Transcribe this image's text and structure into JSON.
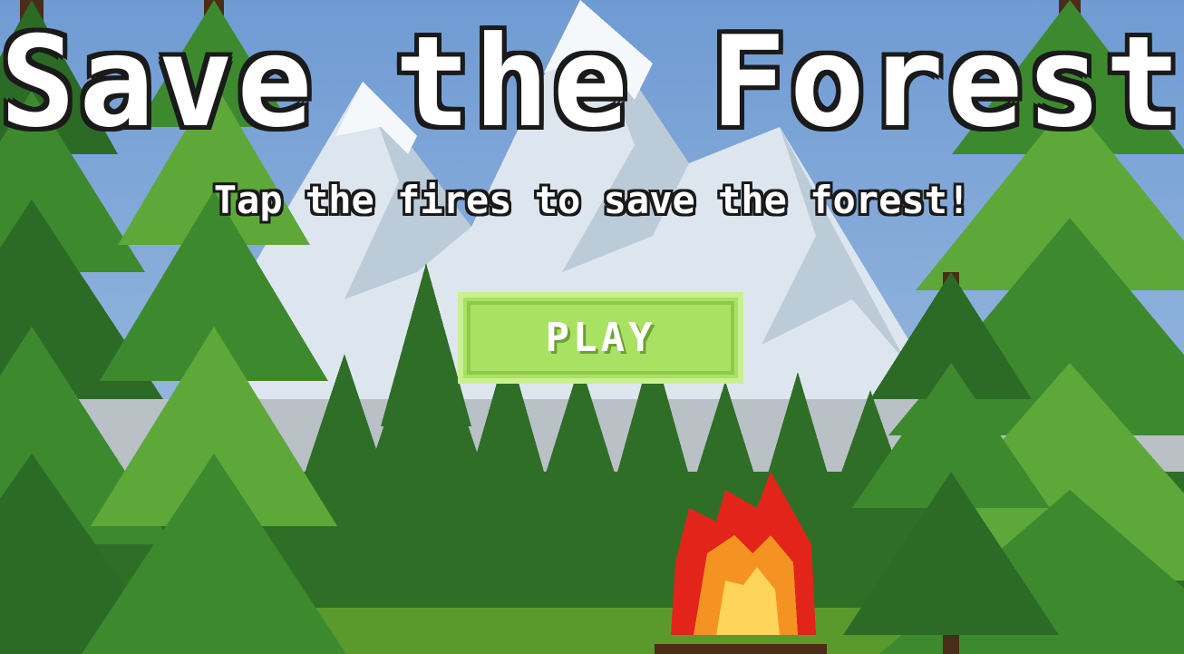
{
  "game": {
    "title": "Save the Forest",
    "subtitle": "Tap the fires to save the forest!",
    "play_label": "PLAY"
  },
  "colors": {
    "sky": "#7aa3d6",
    "mountain": "#e2eaf0",
    "tree_dark": "#2c6b25",
    "tree_light": "#5ea83a",
    "trunk": "#4a2c18",
    "ground": "#5a9a2c",
    "play_button": "#a9e163",
    "fire_red": "#e3241b",
    "fire_orange": "#f59322",
    "fire_yellow": "#ffd45a"
  }
}
